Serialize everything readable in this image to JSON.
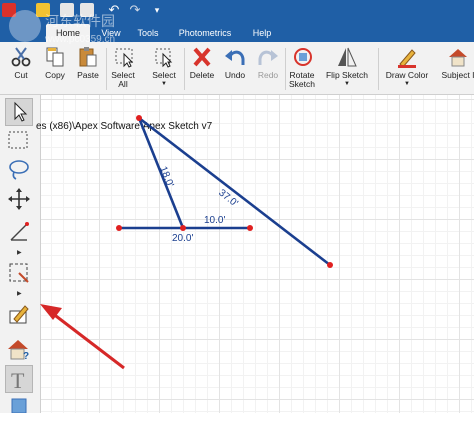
{
  "titlebar": {
    "quick_access": [
      "app-logo-icon",
      "open-folder-icon",
      "save-icon",
      "print-icon",
      "undo-icon",
      "redo-icon",
      "more-icon"
    ]
  },
  "tabs": [
    {
      "label": "Home",
      "active": true
    },
    {
      "label": "View",
      "active": false
    },
    {
      "label": "Tools",
      "active": false
    },
    {
      "label": "Photometrics",
      "active": false
    },
    {
      "label": "Help",
      "active": false
    }
  ],
  "ribbon": {
    "cut": "Cut",
    "copy": "Copy",
    "paste": "Paste",
    "select_all": "Select All",
    "select": "Select",
    "delete": "Delete",
    "undo": "Undo",
    "redo": "Redo",
    "rotate_sketch": "Rotate Sketch",
    "flip_sketch": "Flip Sketch",
    "draw_color": "Draw Color",
    "subject": "Subject I"
  },
  "palette": {
    "tools": [
      "pointer-icon",
      "marquee-select-icon",
      "lasso-select-icon",
      "move-icon",
      "draw-line-icon",
      "area-icon",
      "edit-icon",
      "house-help-icon",
      "text-icon",
      "structure-icon"
    ]
  },
  "canvas": {
    "path_text": "es (x86)\\Apex Software\\Apex Sketch v7",
    "segments": [
      {
        "label": "18.0'"
      },
      {
        "label": "37.0'"
      },
      {
        "label": "10.0'"
      },
      {
        "label": "20.0'"
      }
    ]
  },
  "watermark": {
    "site": "河东软件园",
    "url": "www.pc0359.cn"
  },
  "colors": {
    "title_bar": "#1f5fa6",
    "ribbon": "#f2f2f2",
    "sketch_line": "#1b3f8f",
    "vertex": "#e02020",
    "annotation_arrow": "#d62828"
  }
}
